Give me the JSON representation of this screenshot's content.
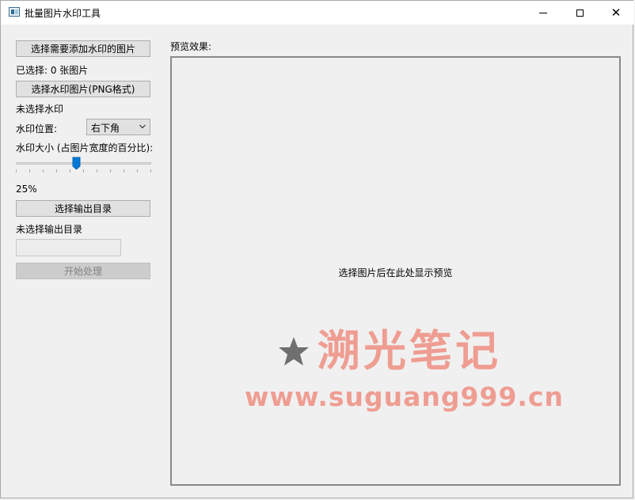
{
  "window": {
    "title": "批量图片水印工具",
    "controls": {
      "minimize": "—",
      "maximize": "□",
      "close": "✕"
    }
  },
  "left_panel": {
    "select_images_button": "选择需要添加水印的图片",
    "selected_count_label": "已选择: 0 张图片",
    "select_watermark_button": "选择水印图片(PNG格式)",
    "watermark_status": "未选择水印",
    "position_label": "水印位置:",
    "position_value": "右下角",
    "size_label": "水印大小 (占图片宽度的百分比):",
    "size_value": 0.25,
    "size_percent_label": "25%",
    "select_output_button": "选择输出目录",
    "output_status": "未选择输出目录",
    "output_path": "",
    "start_button": "开始处理"
  },
  "preview": {
    "label": "预览效果:",
    "placeholder": "选择图片后在此处显示预览"
  },
  "watermark_overlay": {
    "icon": "star-icon",
    "brand": "溯光笔记",
    "url": "www.suguang999.cn",
    "color": "#ef9d92"
  },
  "colors": {
    "accent": "#0078d7",
    "button": "#e1e1e1",
    "disabled_button": "#cccccc"
  }
}
